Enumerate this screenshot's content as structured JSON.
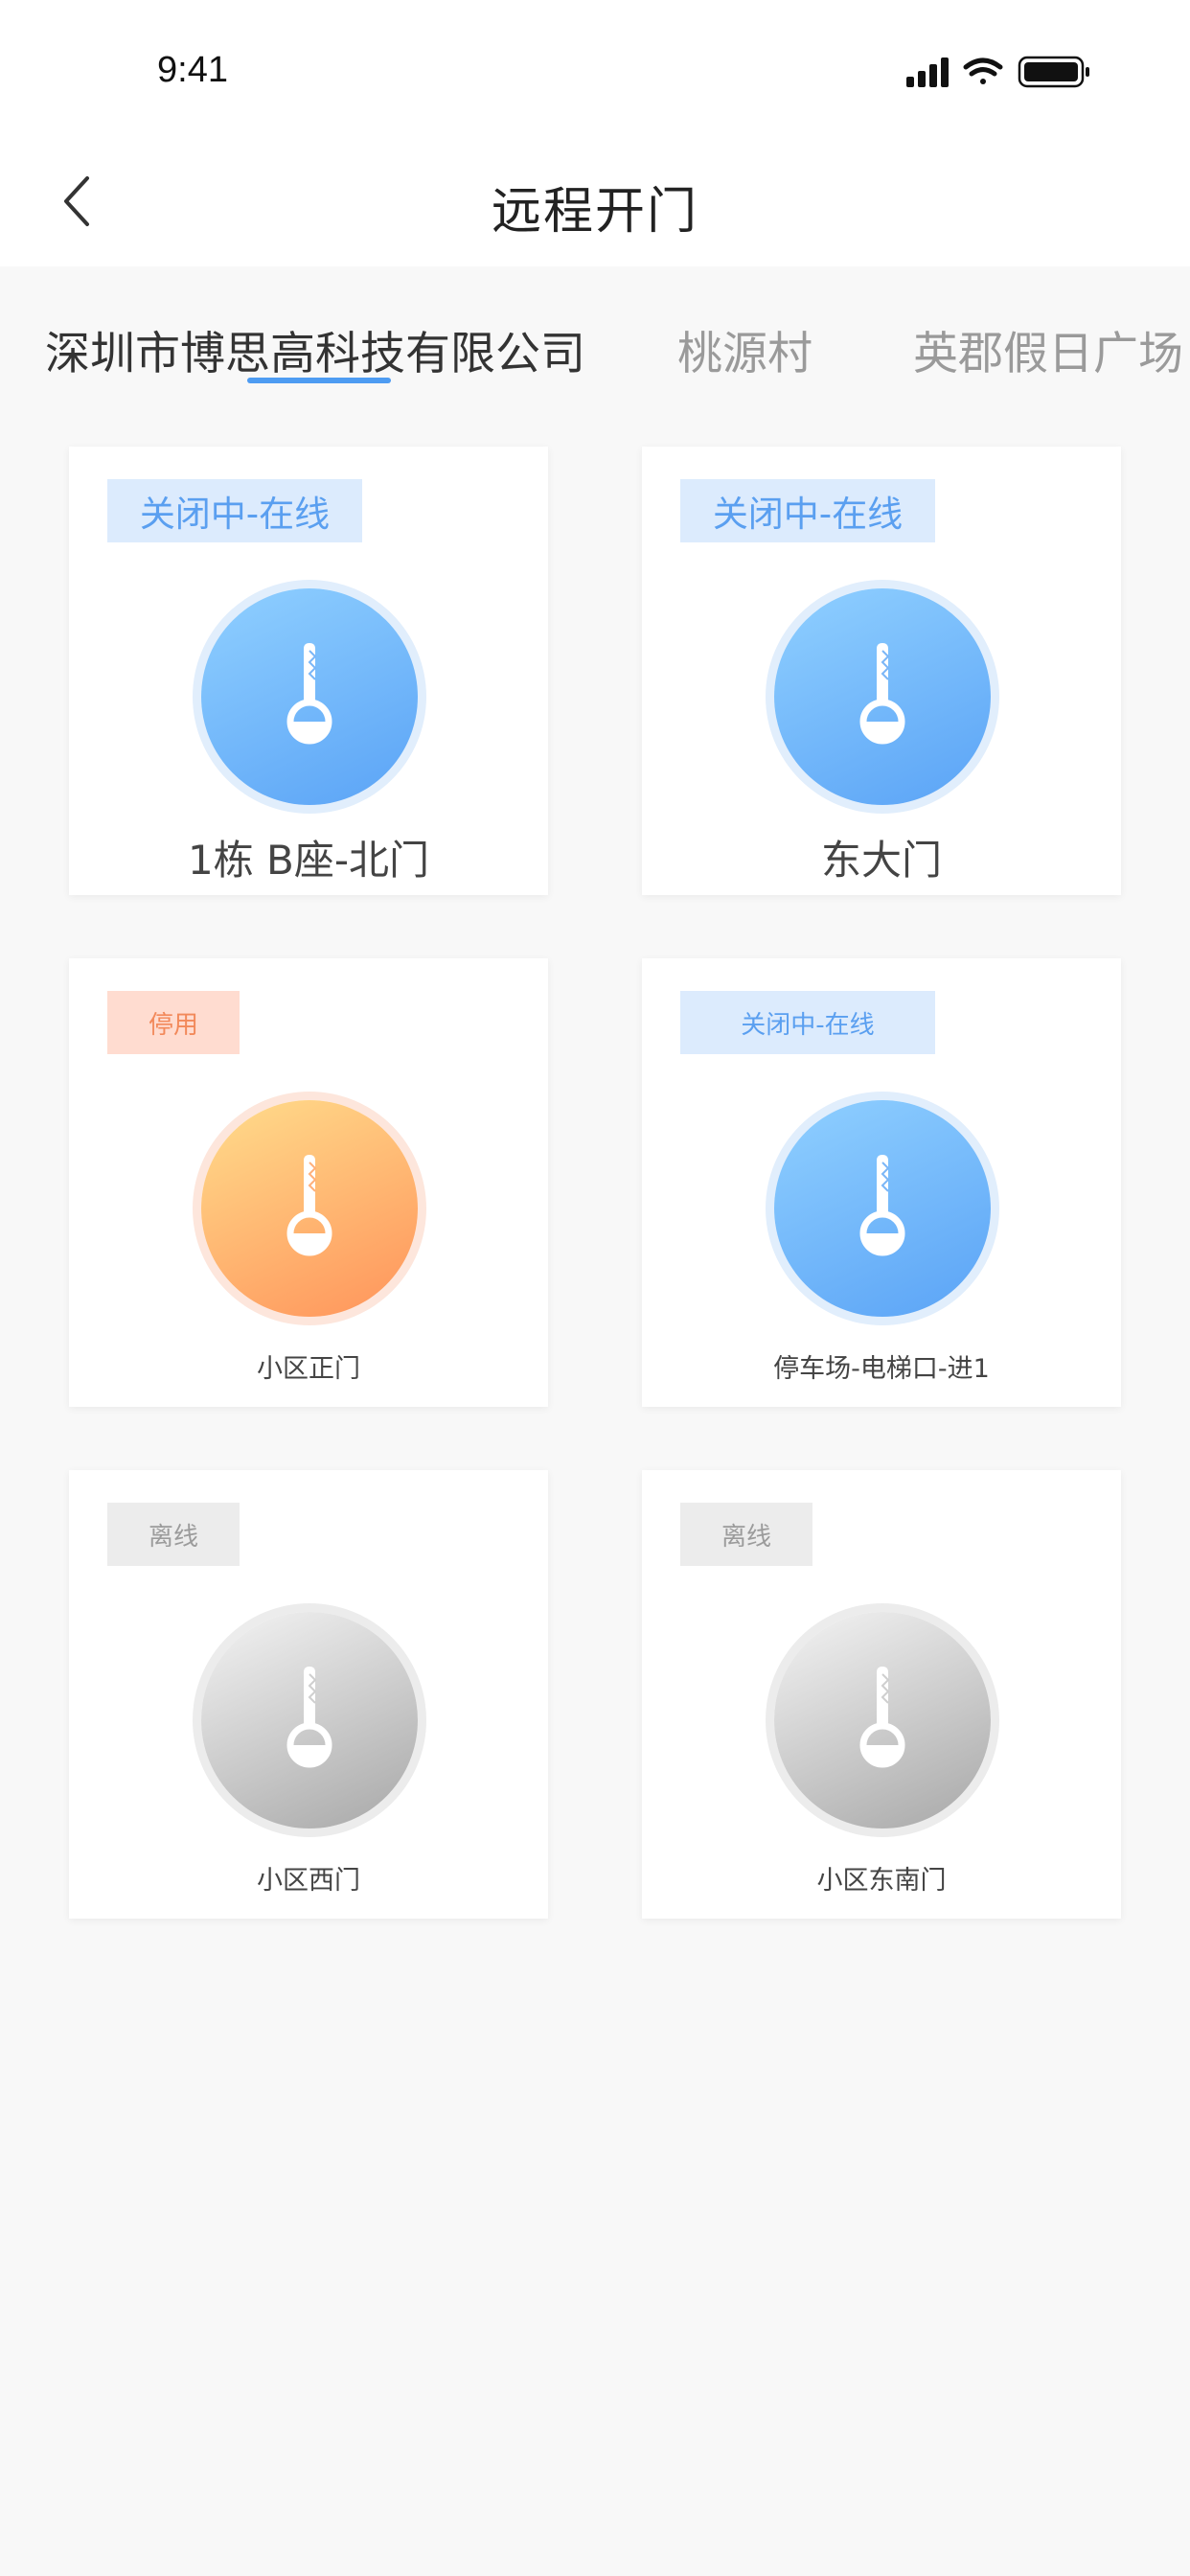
{
  "status_bar": {
    "time": "9:41"
  },
  "header": {
    "title": "远程开门"
  },
  "tabs": [
    {
      "label": "深圳市博思高科技有限公司"
    },
    {
      "label": "桃源村"
    },
    {
      "label": "英郡假日广场"
    }
  ],
  "doors": [
    {
      "status": "关闭中-在线",
      "name": "1栋 B座-北门",
      "state": "online"
    },
    {
      "status": "关闭中-在线",
      "name": "东大门",
      "state": "online"
    },
    {
      "status": "停用",
      "name": "小区正门",
      "state": "disabled"
    },
    {
      "status": "关闭中-在线",
      "name": "停车场-电梯口-进1",
      "state": "online"
    },
    {
      "status": "离线",
      "name": "小区西门",
      "state": "offline"
    },
    {
      "status": "离线",
      "name": "小区东南门",
      "state": "offline"
    }
  ],
  "colors": {
    "accent": "#4e9cf2",
    "online": "#5aa3f6",
    "disabled": "#ff935a",
    "offline": "#a7a7a7"
  },
  "icons": [
    "back-icon",
    "key-icon",
    "signal-icon",
    "wifi-icon",
    "battery-icon"
  ]
}
